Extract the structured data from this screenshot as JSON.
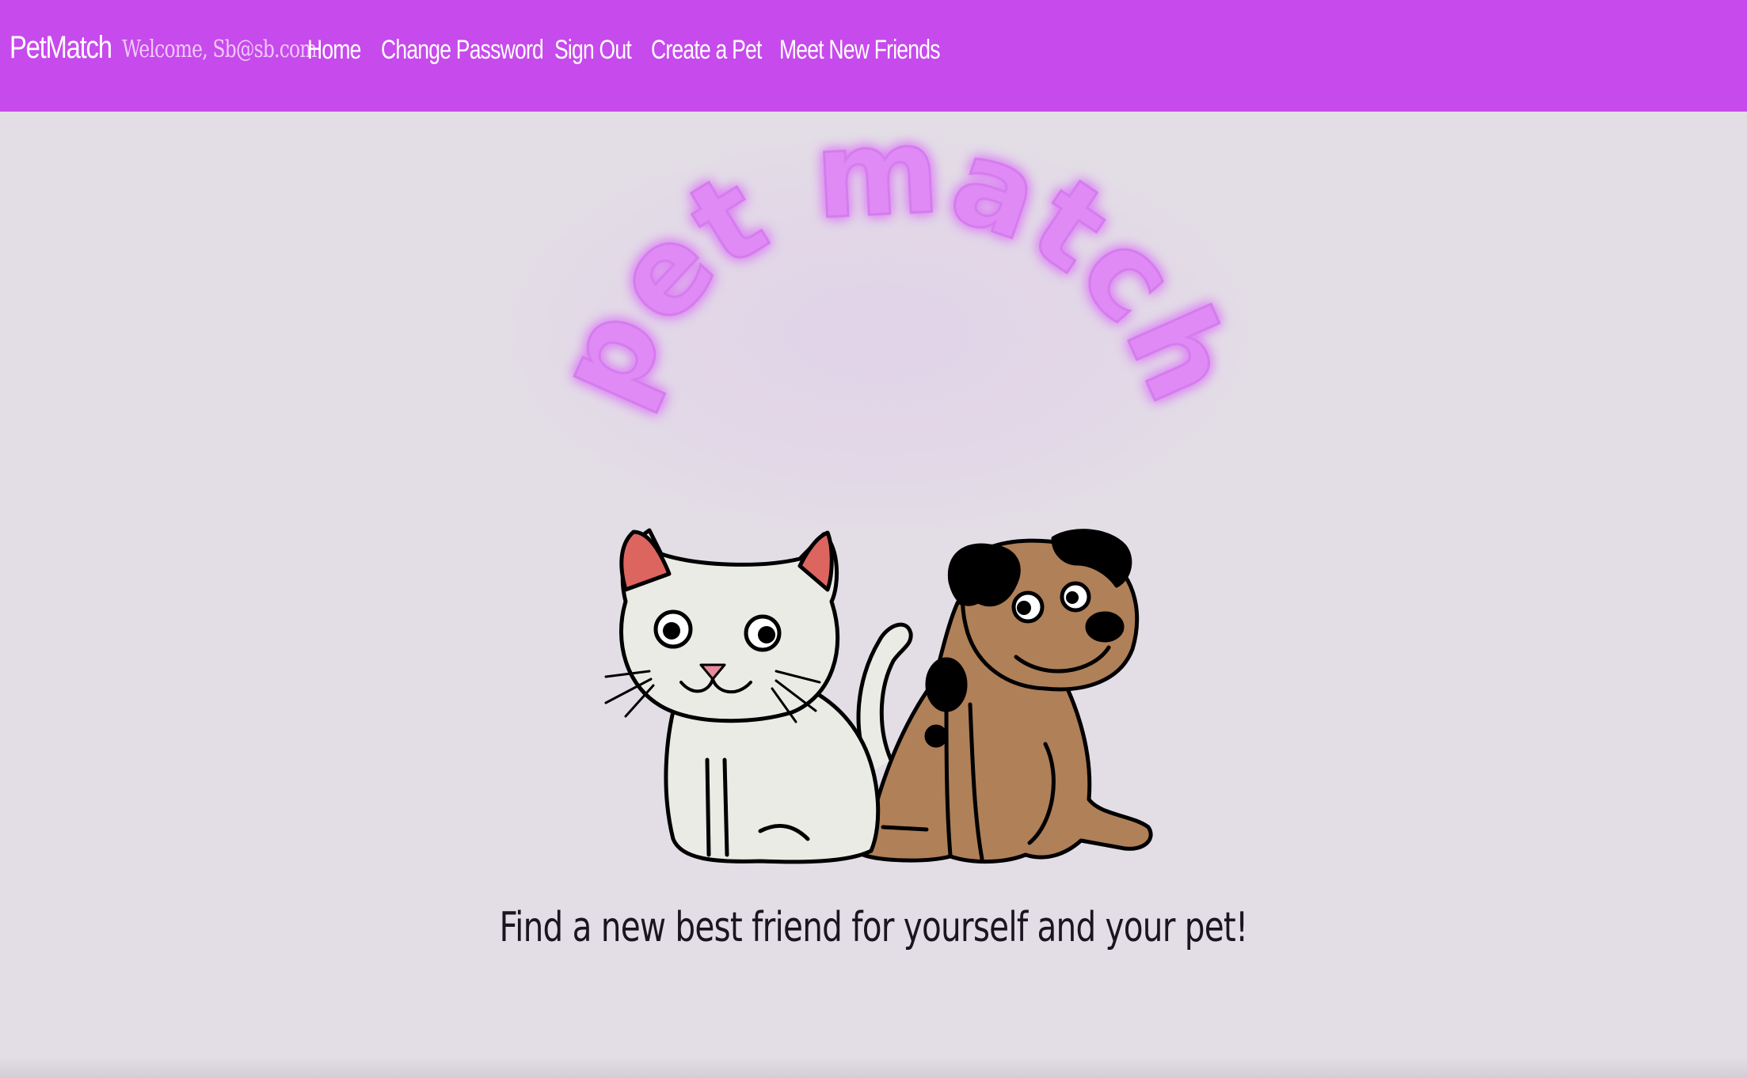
{
  "navbar": {
    "brand": "PetMatch",
    "welcome": "Welcome, Sb@sb.com",
    "links": [
      {
        "label": "Home"
      },
      {
        "label": "Change Password"
      },
      {
        "label": "Sign Out"
      },
      {
        "label": "Create a Pet"
      },
      {
        "label": "Meet New Friends"
      }
    ]
  },
  "hero": {
    "logo_text": "pet match",
    "tagline": "Find a new best friend for yourself and your pet!"
  },
  "colors": {
    "navbar_bg": "#c74aec",
    "page_bg": "#e3dee6",
    "logo_text": "#e08af6",
    "cat_body": "#ebebe6",
    "cat_ear": "#dd6560",
    "dog_body": "#b08058",
    "dog_spots": "#000000"
  },
  "icons": {
    "illustration": "cat-and-dog-illustration"
  }
}
